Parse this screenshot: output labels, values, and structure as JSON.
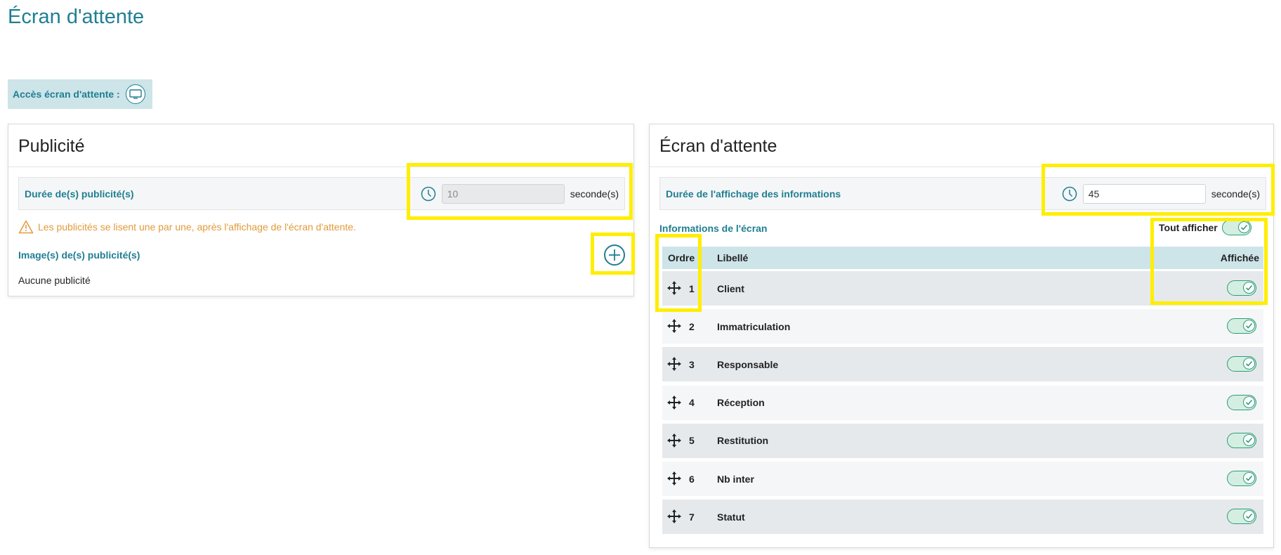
{
  "page": {
    "title": "Écran d'attente"
  },
  "access": {
    "label": "Accès écran d'attente :",
    "icon": "monitor-icon"
  },
  "publicite": {
    "title": "Publicité",
    "duration_label": "Durée de(s) publicité(s)",
    "duration_value": "10",
    "duration_unit": "seconde(s)",
    "warning": "Les publicités se lisent une par une, après l'affichage de l'écran d'attente.",
    "images_label": "Image(s) de(s) publicité(s)",
    "empty_text": "Aucune publicité"
  },
  "ecran": {
    "title": "Écran d'attente",
    "duration_label": "Durée de l'affichage des informations",
    "duration_value": "45",
    "duration_unit": "seconde(s)",
    "info_label": "Informations de l'écran",
    "tout_afficher": "Tout afficher",
    "tout_afficher_on": true,
    "columns": {
      "ordre": "Ordre",
      "libelle": "Libellé",
      "affichee": "Affichée"
    },
    "rows": [
      {
        "ordre": "1",
        "libelle": "Client",
        "affichee": true
      },
      {
        "ordre": "2",
        "libelle": "Immatriculation",
        "affichee": true
      },
      {
        "ordre": "3",
        "libelle": "Responsable",
        "affichee": true
      },
      {
        "ordre": "4",
        "libelle": "Réception",
        "affichee": true
      },
      {
        "ordre": "5",
        "libelle": "Restitution",
        "affichee": true
      },
      {
        "ordre": "6",
        "libelle": "Nb inter",
        "affichee": true
      },
      {
        "ordre": "7",
        "libelle": "Statut",
        "affichee": true
      }
    ]
  },
  "colors": {
    "accent": "#1f7f93",
    "highlight": "#ffee00",
    "toggle_on": "#2e9b78",
    "warning": "#e29a3c"
  }
}
